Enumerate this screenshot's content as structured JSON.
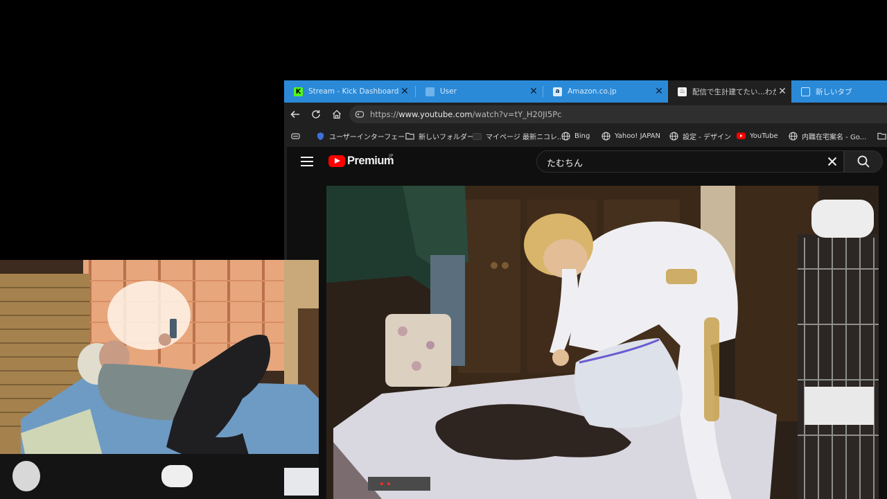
{
  "browser": {
    "tabs": [
      {
        "title": "Stream - Kick Dashboard",
        "favicon": "kick-icon",
        "color": "#53fc18",
        "active": false
      },
      {
        "title": "User",
        "favicon": "user-icon",
        "color": "#5aa0e0",
        "active": false
      },
      {
        "title": "Amazon.co.jp",
        "favicon": "amazon-icon",
        "color": "#2b2b2b",
        "active": false
      },
      {
        "title": "配信で生計建てたい…わかってん…",
        "favicon": "page-icon",
        "color": "#ffffff",
        "active": true
      },
      {
        "title": "新しいタブ",
        "favicon": "new-tab-icon",
        "color": "#ffffff",
        "active": false
      }
    ],
    "url_prefix": "https://",
    "url_host": "www.youtube.com",
    "url_path": "/watch?v=tY_H20JI5Pc",
    "bookmarks": [
      {
        "label": "",
        "icon": "bookmarks-icon"
      },
      {
        "label": "ユーザーインターフェー...",
        "icon": "shield-icon"
      },
      {
        "label": "新しいフォルダー",
        "icon": "folder-icon"
      },
      {
        "label": "マイページ 最新ニコレ...",
        "icon": "niconico-icon"
      },
      {
        "label": "Bing",
        "icon": "globe-icon"
      },
      {
        "label": "Yahoo! JAPAN",
        "icon": "globe-icon"
      },
      {
        "label": "設定 - デザイン",
        "icon": "globe-icon"
      },
      {
        "label": "YouTube",
        "icon": "youtube-icon"
      },
      {
        "label": "内職在宅案名 - Go...",
        "icon": "globe-icon"
      },
      {
        "label": "",
        "icon": "folder-icon"
      }
    ]
  },
  "youtube": {
    "brand": "Premium",
    "region": "JP",
    "search_query": "たむちん"
  },
  "colors": {
    "tabbar": "#2b8ad8",
    "youtube_red": "#ff0000",
    "page_bg": "#0f0f0f"
  }
}
